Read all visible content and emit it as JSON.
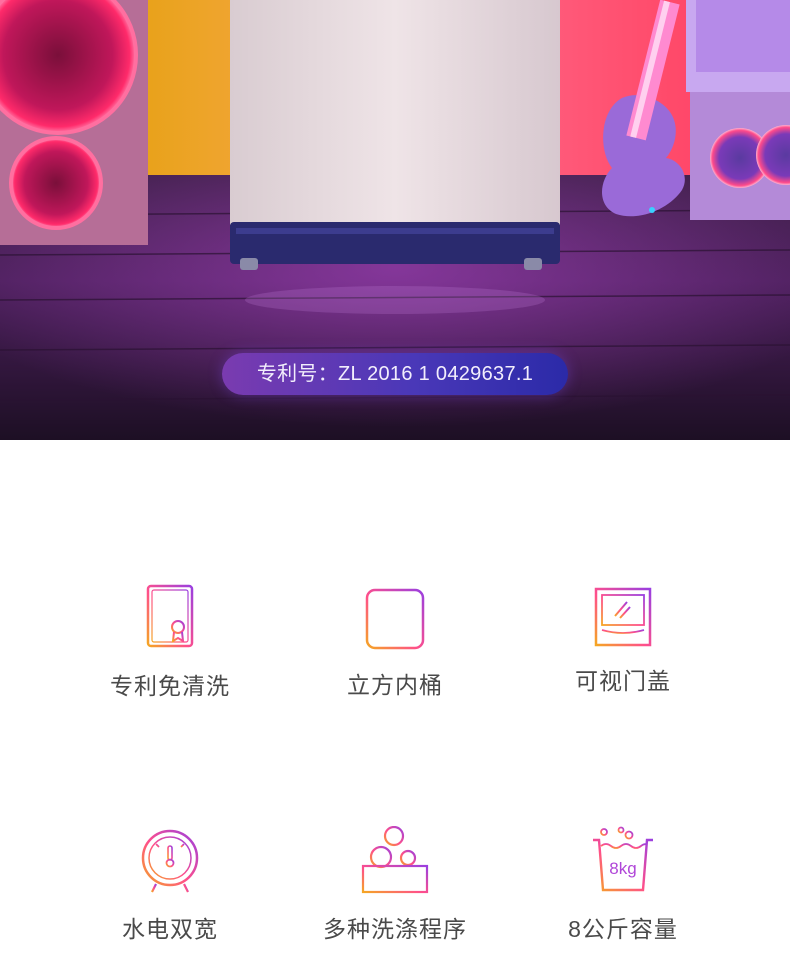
{
  "hero": {
    "patent_text": "专利号：ZL 2016 1 0429637.1"
  },
  "features": [
    {
      "label": "专利免清洗",
      "icon": "certificate-icon"
    },
    {
      "label": "立方内桶",
      "icon": "cube-drum-icon"
    },
    {
      "label": "可视门盖",
      "icon": "glass-lid-icon"
    },
    {
      "label": "水电双宽",
      "icon": "gauge-icon"
    },
    {
      "label": "多种洗涤程序",
      "icon": "bubbles-icon"
    },
    {
      "label": "8公斤容量",
      "icon": "capacity-tub-icon",
      "badge": "8kg"
    }
  ],
  "colors": {
    "icon_gradient": [
      "#f5a623",
      "#ff4f8b",
      "#b04be0",
      "#7a3bd8"
    ],
    "label": "#4a4a4a"
  }
}
